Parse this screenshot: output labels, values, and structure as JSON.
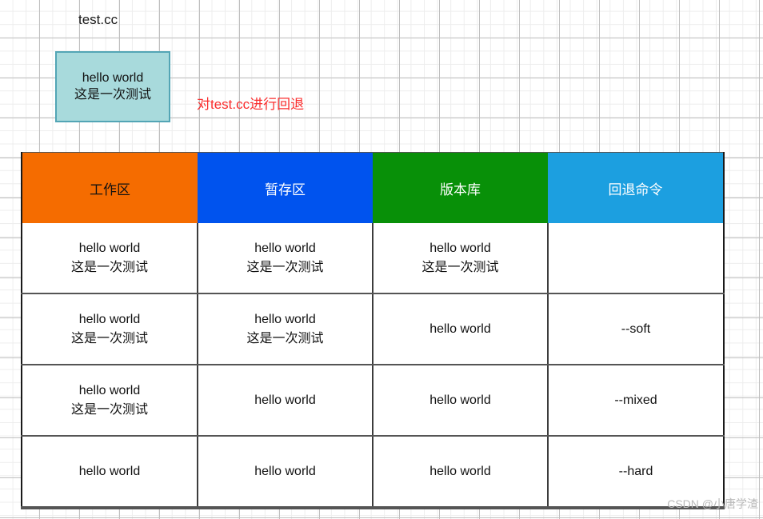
{
  "canvas": {
    "background": "#ffffff",
    "grid_minor_color": "#ededed",
    "grid_major_color": "#bfbfbf"
  },
  "file_label": {
    "text": "test.cc"
  },
  "file_box": {
    "fill": "#a8dadc",
    "border": "#53a5b5",
    "lines": [
      "hello world",
      "这是一次测试"
    ]
  },
  "annotation": {
    "text": "对test.cc进行回退",
    "color": "#fa2d2d"
  },
  "table": {
    "headers": [
      {
        "label": "工作区",
        "bg": "#f56c00",
        "fg": "#111111"
      },
      {
        "label": "暂存区",
        "bg": "#0053ee",
        "fg": "#ffffff"
      },
      {
        "label": "版本库",
        "bg": "#089008",
        "fg": "#ffffff"
      },
      {
        "label": "回退命令",
        "bg": "#1c9fe0",
        "fg": "#ffffff"
      }
    ],
    "rows": [
      {
        "workspace": [
          "hello world",
          "这是一次测试"
        ],
        "staging": [
          "hello world",
          "这是一次测试"
        ],
        "repository": [
          "hello world",
          "这是一次测试"
        ],
        "command": []
      },
      {
        "workspace": [
          "hello world",
          "这是一次测试"
        ],
        "staging": [
          "hello world",
          "这是一次测试"
        ],
        "repository": [
          "hello world"
        ],
        "command": [
          "--soft"
        ]
      },
      {
        "workspace": [
          "hello world",
          "这是一次测试"
        ],
        "staging": [
          "hello world"
        ],
        "repository": [
          "hello world"
        ],
        "command": [
          "--mixed"
        ]
      },
      {
        "workspace": [
          "hello world"
        ],
        "staging": [
          "hello world"
        ],
        "repository": [
          "hello world"
        ],
        "command": [
          "--hard"
        ]
      }
    ]
  },
  "watermark": {
    "text": "CSDN @小唐学渣"
  }
}
